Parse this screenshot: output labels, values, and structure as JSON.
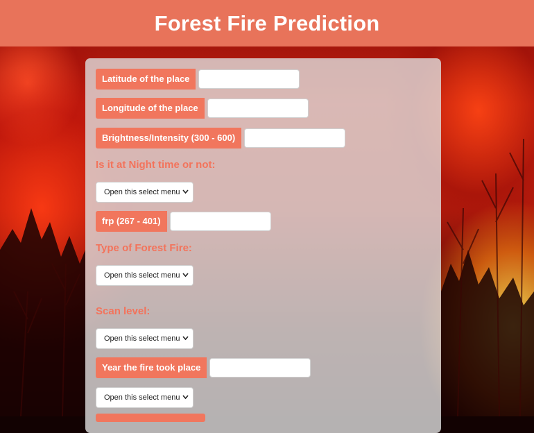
{
  "header": {
    "title": "Forest Fire Prediction"
  },
  "form": {
    "latitude_label": "Latitude of the place",
    "longitude_label": "Longitude of the place",
    "brightness_label": "Brightness/Intensity (300 - 600)",
    "night_question": "Is it at Night time or not:",
    "night_select": "Open this select menu",
    "frp_label": "frp (267 - 401)",
    "fire_type_question": "Type of Forest Fire:",
    "fire_type_select": "Open this select menu",
    "scan_question": "Scan level:",
    "scan_select": "Open this select menu",
    "year_label": "Year the fire took place",
    "year_select": "Open this select menu"
  },
  "colors": {
    "header_bg": "#e8735a",
    "label_bg": "#f1765d",
    "question_text": "#f3735b",
    "panel_bg": "#dedede"
  },
  "icons": {
    "select_arrow": "chevron-down-icon"
  }
}
